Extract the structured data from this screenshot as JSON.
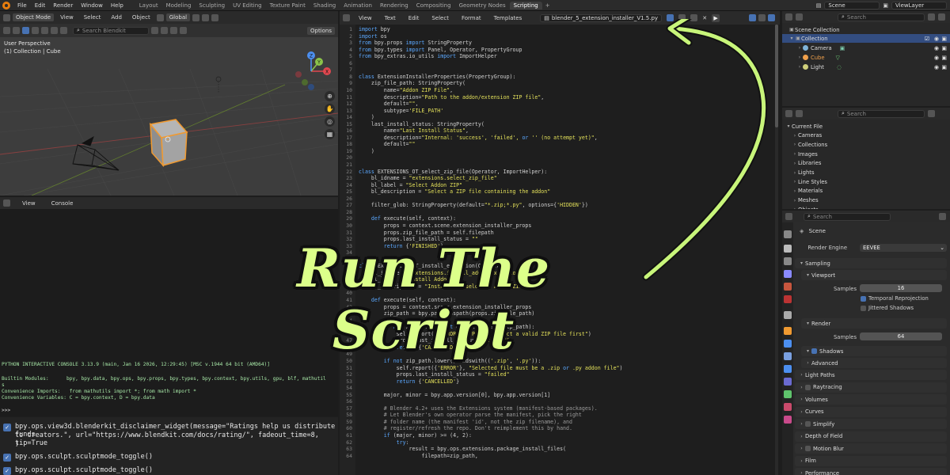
{
  "app": {
    "menu": [
      "File",
      "Edit",
      "Render",
      "Window",
      "Help"
    ],
    "workspaces": [
      "Layout",
      "Modeling",
      "Sculpting",
      "UV Editing",
      "Texture Paint",
      "Shading",
      "Animation",
      "Rendering",
      "Compositing",
      "Geometry Nodes",
      "Scripting"
    ],
    "active_workspace": "Scripting",
    "scene_name": "Scene",
    "view_layer": "ViewLayer"
  },
  "viewport": {
    "mode": "Object Mode",
    "menus": [
      "View",
      "Select",
      "Add",
      "Object"
    ],
    "transform": "Global",
    "search_placeholder": "Search Blendkit",
    "options": "Options",
    "perspective_label": "User Perspective",
    "collection_label": "(1) Collection | Cube",
    "axes": {
      "x": "X",
      "y": "Y",
      "z": "Z"
    }
  },
  "console": {
    "menus": [
      "View",
      "Console"
    ],
    "lines": [
      "PYTHON INTERACTIVE CONSOLE 3.13.9 (main, Jan 16 2026, 12:29:45) [MSC v.1944 64 bit (AMD64)]",
      "",
      "Builtin Modules:      bpy, bpy.data, bpy.ops, bpy.props, bpy.types, bpy.context, bpy.utils, gpu, blf, mathutil",
      "s",
      "Convenience Imports:   from mathutils import *; from math import *",
      "Convenience Variables: C = bpy.context, D = bpy.data"
    ],
    "prompt": ">>> "
  },
  "info_log": [
    "bpy.ops.view3d.blenderkit_disclaimer_widget(message=\"Ratings help us distribute funds",
    "  to creators.\", url=\"https://www.blendkit.com/docs/rating/\", fadeout_time=8, tip=True",
    "  )",
    "bpy.ops.sculpt.sculptmode_toggle()",
    "bpy.ops.sculpt.sculptmode_toggle()"
  ],
  "editor": {
    "menus": [
      "View",
      "Text",
      "Edit",
      "Select",
      "Format",
      "Templates"
    ],
    "filename": "blender_5_extension_installer_V1.5.py",
    "code": [
      "import bpy",
      "import os",
      "from bpy.props import StringProperty",
      "from bpy.types import Panel, Operator, PropertyGroup",
      "from bpy_extras.io_utils import ImportHelper",
      "",
      "",
      "class ExtensionInstallerProperties(PropertyGroup):",
      "    zip_file_path: StringProperty(",
      "        name=\"Addon ZIP File\",",
      "        description=\"Path to the addon/extension ZIP file\",",
      "        default=\"\",",
      "        subtype='FILE_PATH'",
      "    )",
      "    last_install_status: StringProperty(",
      "        name=\"Last Install Status\",",
      "        description=\"Internal: 'success', 'failed', or '' (no attempt yet)\",",
      "        default=\"\"",
      "    )",
      "",
      "",
      "class EXTENSIONS_OT_select_zip_file(Operator, ImportHelper):",
      "    bl_idname = \"extensions.select_zip_file\"",
      "    bl_label = \"Select Addon ZIP\"",
      "    bl_description = \"Select a ZIP file containing the addon\"",
      "",
      "    filter_glob: StringProperty(default=\"*.zip;*.py\", options={'HIDDEN'})",
      "",
      "    def execute(self, context):",
      "        props = context.scene.extension_installer_props",
      "        props.zip_file_path = self.filepath",
      "        props.last_install_status = \"\"",
      "        return {'FINISHED'}",
      "",
      "",
      "class EXTENSIONS_OT_install_extension(Operator):",
      "    bl_idname = \"extensions.install_addon_extension\"",
      "    bl_label = \"Install Addon\"",
      "    bl_description = \"Install the selected addon ZIP file\"",
      "",
      "    def execute(self, context):",
      "        props = context.scene.extension_installer_props",
      "        zip_path = bpy.path.abspath(props.zip_file_path)",
      "",
      "        if not zip_path or not os.path.exists(zip_path):",
      "            self.report({'ERROR'}, \"Please select a valid ZIP file first\")",
      "            props.last_install_status = \"failed\"",
      "            return {'CANCELLED'}",
      "",
      "        if not zip_path.lower().endswith(('.zip', '.py')):",
      "            self.report({'ERROR'}, \"Selected file must be a .zip or .py addon file\")",
      "            props.last_install_status = \"failed\"",
      "            return {'CANCELLED'}",
      "",
      "        major, minor = bpy.app.version[0], bpy.app.version[1]",
      "",
      "        # Blender 4.2+ uses the Extensions system (manifest-based packages).",
      "        # Let Blender's own operator parse the manifest, pick the right",
      "        # folder name (the manifest 'id', not the zip filename), and",
      "        # register/refresh the repo. Don't reimplement this by hand.",
      "        if (major, minor) >= (4, 2):",
      "            try:",
      "                result = bpy.ops.extensions.package_install_files(",
      "                    filepath=zip_path,"
    ]
  },
  "outliner": {
    "search_placeholder": "Search",
    "items": [
      {
        "label": "Scene Collection",
        "color": "#cccccc"
      },
      {
        "label": "Collection",
        "color": "#ffffff"
      },
      {
        "label": "Camera",
        "color": "#cfcfcf"
      },
      {
        "label": "Cube",
        "color": "#f0a04b"
      },
      {
        "label": "Light",
        "color": "#cfcfcf"
      }
    ]
  },
  "data_panel": {
    "search_placeholder": "Search",
    "items": [
      "Current File",
      "Cameras",
      "Collections",
      "Images",
      "Libraries",
      "Lights",
      "Line Styles",
      "Materials",
      "Meshes",
      "Objects"
    ]
  },
  "properties": {
    "search_placeholder": "Search",
    "scene": "Scene",
    "render_engine_label": "Render Engine",
    "render_engine": "EEVEE",
    "sampling": "Sampling",
    "viewport": "Viewport",
    "samples_label": "Samples",
    "viewport_samples": "16",
    "temporal_reprojection": "Temporal Reprojection",
    "jittered_shadows": "Jittered Shadows",
    "render": "Render",
    "render_samples": "64",
    "shadows": "Shadows",
    "advanced": "Advanced",
    "panels": [
      "Light Paths",
      "Raytracing",
      "Volumes",
      "Curves",
      "Simplify",
      "Depth of Field",
      "Motion Blur",
      "Film",
      "Performance"
    ]
  },
  "overlay": {
    "title": "Run The Script",
    "arrow_color": "#c8f57a"
  }
}
